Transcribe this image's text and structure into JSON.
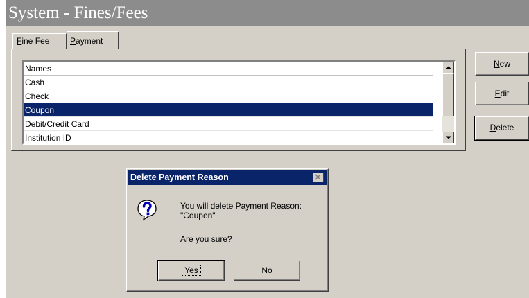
{
  "window": {
    "title": "System - Fines/Fees"
  },
  "tabs": [
    {
      "label_prefix": "",
      "mnemonic": "F",
      "label_rest": "ine Fee"
    },
    {
      "label_prefix": "",
      "mnemonic": "P",
      "label_rest": "ayment"
    }
  ],
  "list": {
    "header": "Names",
    "items": [
      "Cash",
      "Check",
      "Coupon",
      "Debit/Credit Card",
      "Institution ID"
    ],
    "selected": "Coupon"
  },
  "buttons": {
    "new": {
      "mnemonic": "N",
      "rest": "ew"
    },
    "edit": {
      "mnemonic": "E",
      "rest": "dit"
    },
    "delete": {
      "mnemonic": "D",
      "rest": "elete"
    }
  },
  "dialog": {
    "title": "Delete Payment Reason",
    "message_line1": "You will delete Payment Reason:",
    "message_line2": "\"Coupon\"",
    "message_line3": "Are you sure?",
    "yes_label": "Yes",
    "no_label": "No",
    "icon": "question-icon"
  },
  "colors": {
    "selection": "#0a246a",
    "title_bar": "#8c8c8c",
    "dialog_title": "#0a246a"
  }
}
